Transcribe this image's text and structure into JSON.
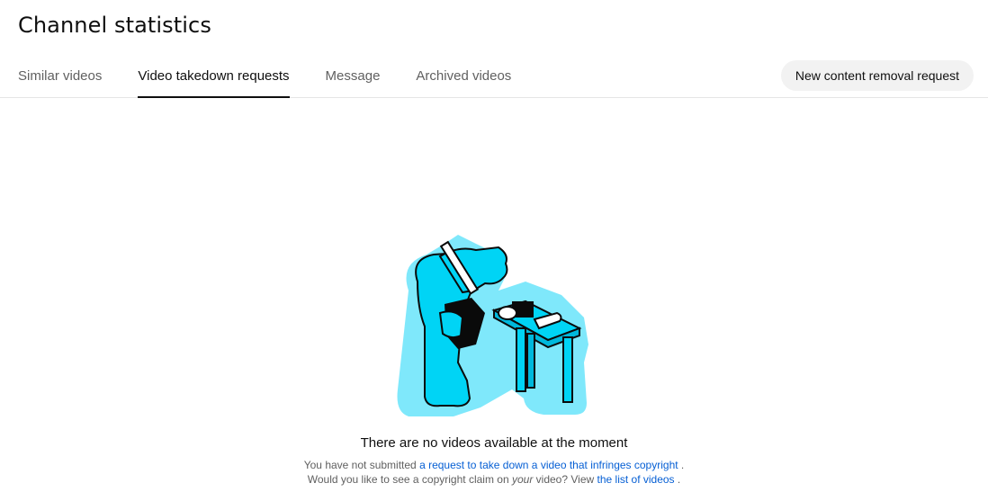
{
  "header": {
    "title": "Channel statistics"
  },
  "tabs": [
    {
      "label": "Similar videos",
      "active": false
    },
    {
      "label": "Video takedown requests",
      "active": true
    },
    {
      "label": "Message",
      "active": false
    },
    {
      "label": "Archived videos",
      "active": false
    }
  ],
  "actions": {
    "new_request_label": "New content removal request"
  },
  "empty_state": {
    "illustration_icon": "inspector-with-magnifier-illustration",
    "title": "There are no videos available at the moment",
    "line1_prefix": "You have not submitted",
    "line1_link": "a request to take down a video that infringes copyright",
    "line1_suffix": ".",
    "line2_prefix": "Would you like to see a copyright claim on",
    "line2_emphasis": "your",
    "line2_middle": "video? View",
    "line2_link": "the list of videos",
    "line2_suffix": "."
  },
  "colors": {
    "accent": "#0f0f0f",
    "link": "#065fd4",
    "illustration_fill": "#00d4f5",
    "illustration_halo": "#7fe8fb"
  }
}
